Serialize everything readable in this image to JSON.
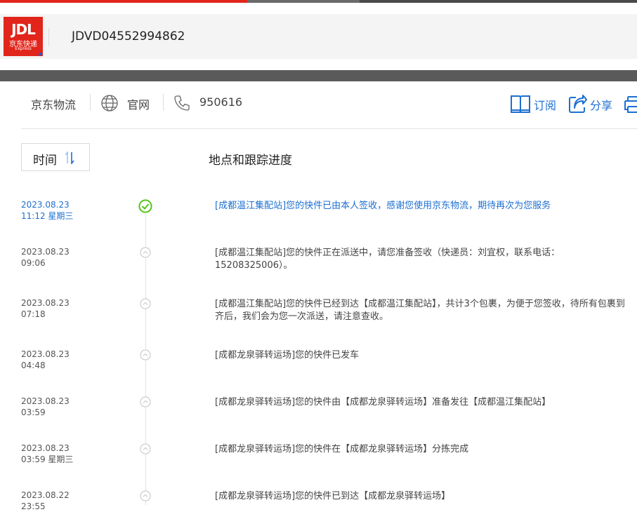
{
  "header": {
    "logo_text": "JDL",
    "logo_cn": "京东快递",
    "logo_en": "Express",
    "tracking_number": "JDVD04552994862"
  },
  "infobar": {
    "carrier": "京东物流",
    "website_label": "官网",
    "phone": "950616",
    "subscribe_label": "订阅",
    "share_label": "分享"
  },
  "list_header": {
    "sort_label": "时间",
    "column_title": "地点和跟踪进度"
  },
  "colors": {
    "brand_red": "#e1251b",
    "link_blue": "#1c6fd1",
    "check_green": "#52c41a"
  },
  "events": [
    {
      "date": "2023.08.23",
      "time": "11:12 星期三",
      "text": "[成都温江集配站]您的快件已由本人签收，感谢您使用京东物流，期待再次为您服务",
      "status": "delivered"
    },
    {
      "date": "2023.08.23",
      "time": "09:06",
      "text": "[成都温江集配站]您的快件正在派送中，请您准备签收（快递员：刘宜权，联系电话：15208325006）。",
      "status": "normal"
    },
    {
      "date": "2023.08.23",
      "time": "07:18",
      "text": "[成都温江集配站]您的快件已经到达【成都温江集配站】，共计3个包裹，为便于您签收，待所有包裹到齐后，我们会为您一次派送，请注意查收。",
      "status": "normal"
    },
    {
      "date": "2023.08.23",
      "time": "04:48",
      "text": "[成都龙泉驿转运场]您的快件已发车",
      "status": "normal"
    },
    {
      "date": "2023.08.23",
      "time": "03:59",
      "text": "[成都龙泉驿转运场]您的快件由【成都龙泉驿转运场】准备发往【成都温江集配站】",
      "status": "normal"
    },
    {
      "date": "2023.08.23",
      "time": "03:59 星期三",
      "text": "[成都龙泉驿转运场]您的快件在【成都龙泉驿转运场】分拣完成",
      "status": "normal"
    },
    {
      "date": "2023.08.22",
      "time": "23:55",
      "text": "[成都龙泉驿转运场]您的快件已到达【成都龙泉驿转运场】",
      "status": "normal"
    }
  ]
}
